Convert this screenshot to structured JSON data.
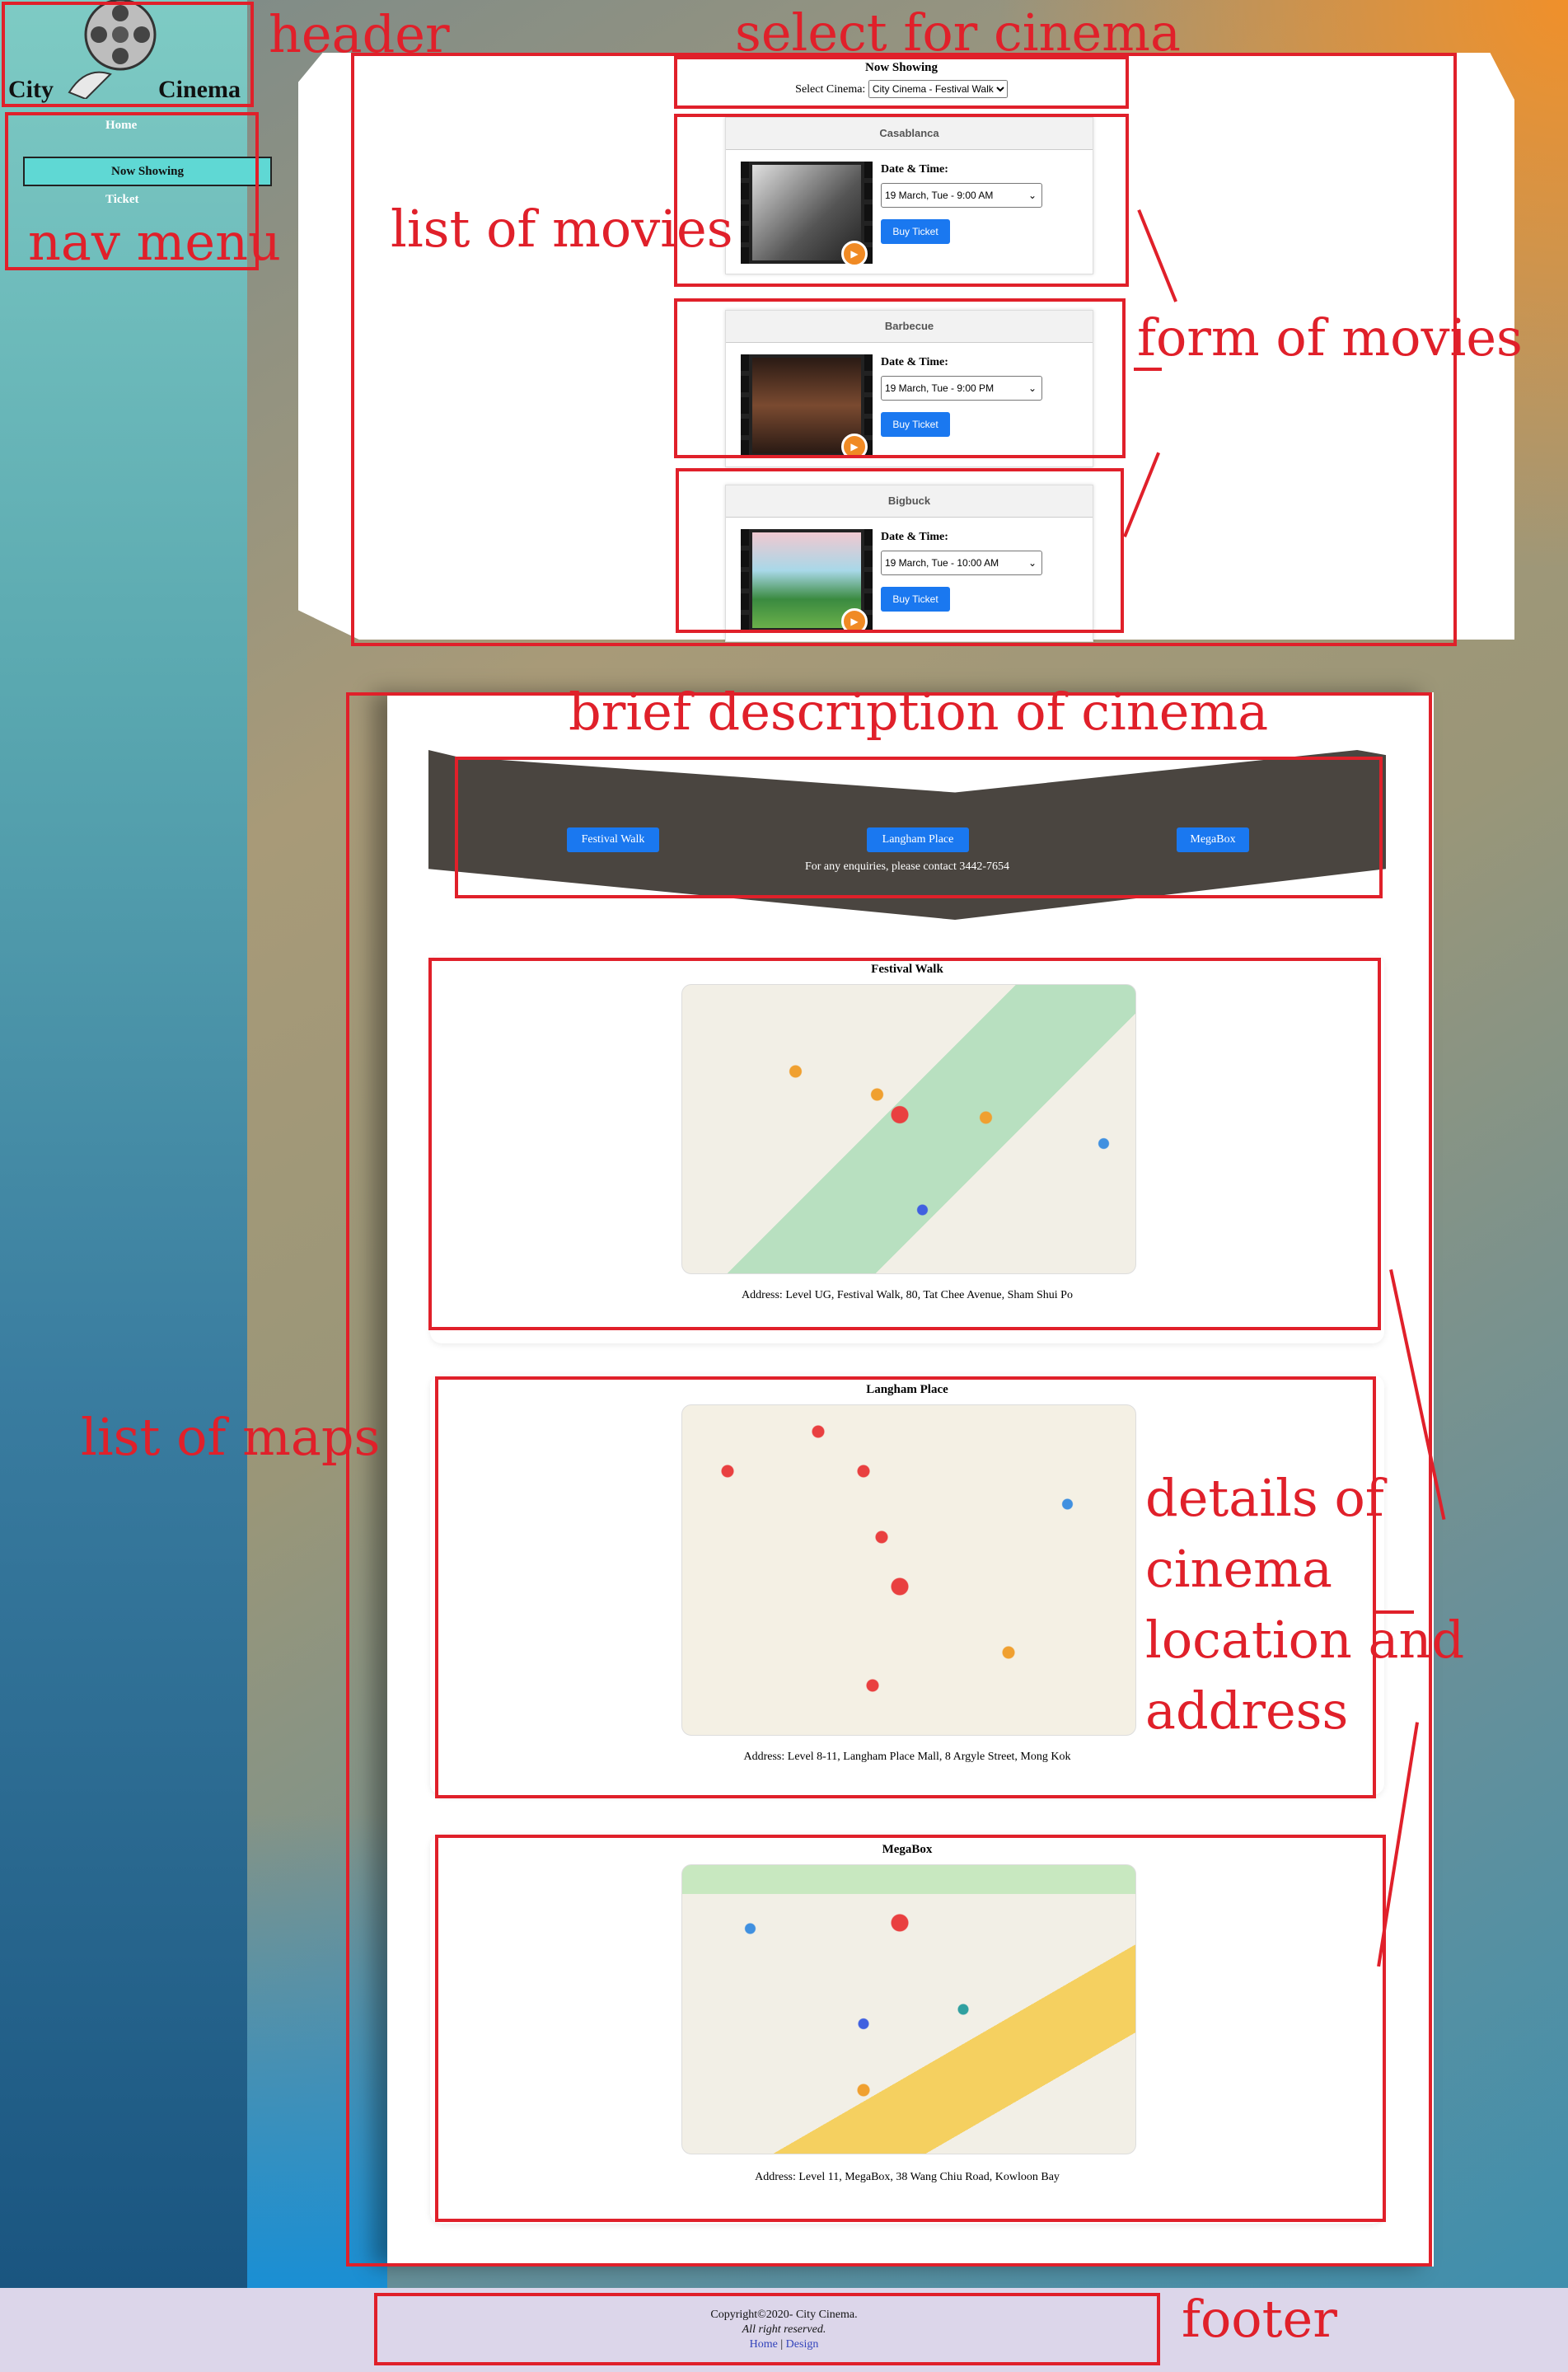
{
  "logo": {
    "city": "City",
    "cinema": "Cinema"
  },
  "nav": {
    "home": "Home",
    "now_showing": "Now Showing",
    "ticket": "Ticket"
  },
  "now_showing": {
    "title": "Now Showing",
    "select_label": "Select Cinema:",
    "select_value": "City Cinema - Festival Walk"
  },
  "movies": [
    {
      "title": "Casablanca",
      "date_label": "Date & Time:",
      "datetime": "19 March, Tue - 9:00 AM",
      "button": "Buy Ticket"
    },
    {
      "title": "Barbecue",
      "date_label": "Date & Time:",
      "datetime": "19 March, Tue - 9:00 PM",
      "button": "Buy Ticket"
    },
    {
      "title": "Bigbuck",
      "date_label": "Date & Time:",
      "datetime": "19 March, Tue - 10:00 AM",
      "button": "Buy Ticket"
    }
  ],
  "banner": {
    "buttons": [
      "Festival Walk",
      "Langham Place",
      "MegaBox"
    ],
    "enquiry": "For any enquiries, please contact 3442-7654"
  },
  "maps": [
    {
      "title": "Festival Walk",
      "address": "Address: Level UG, Festival Walk, 80, Tat Chee Avenue, Sham Shui Po"
    },
    {
      "title": "Langham Place",
      "address": "Address: Level 8-11, Langham Place Mall, 8 Argyle Street, Mong Kok"
    },
    {
      "title": "MegaBox",
      "address": "Address: Level 11, MegaBox, 38 Wang Chiu Road, Kowloon Bay"
    }
  ],
  "footer": {
    "copyright": "Copyright©2020- City Cinema.",
    "rights": "All right reserved.",
    "links": [
      "Home",
      "Design"
    ],
    "separator": "|"
  },
  "annotations": {
    "header": "header",
    "select_for_cinema": "select for cinema",
    "nav_menu": "nav menu",
    "list_of_movies": "list of movies",
    "form_of_movies": "form of movies",
    "brief_description": "brief description of cinema",
    "list_of_maps": "list of maps",
    "details_1": "details of",
    "details_2": "cinema",
    "details_3": "location and",
    "details_4": "address",
    "footer": "footer"
  },
  "colors": {
    "annotation": "#e0202a",
    "button": "#1a78f0",
    "nav_active": "#5fd8d4",
    "footer_bg": "#dcd6ea"
  }
}
